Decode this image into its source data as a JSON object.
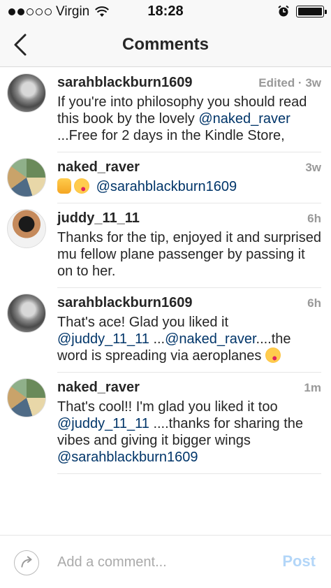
{
  "status_bar": {
    "carrier": "Virgin",
    "time": "18:28",
    "icons": [
      "signal-dots-icon",
      "wifi-icon",
      "alarm-icon",
      "battery-icon"
    ]
  },
  "header": {
    "back_icon": "chevron-left-icon",
    "title": "Comments"
  },
  "comments": [
    {
      "username": "sarahblackburn1609",
      "meta": "Edited · 3w",
      "avatar": "sarah",
      "parts": [
        {
          "t": "text",
          "v": "If you're into philosophy you should read this book by the lovely "
        },
        {
          "t": "mention",
          "v": "@naked_raver"
        },
        {
          "t": "text",
          "v": " ...Free for 2 days in the Kindle Store,"
        }
      ]
    },
    {
      "username": "naked_raver",
      "meta": "3w",
      "avatar": "raver",
      "parts": [
        {
          "t": "emoji",
          "v": "thumb"
        },
        {
          "t": "emoji",
          "v": "kiss"
        },
        {
          "t": "text",
          "v": " "
        },
        {
          "t": "mention",
          "v": "@sarahblackburn1609"
        }
      ]
    },
    {
      "username": "juddy_11_11",
      "meta": "6h",
      "avatar": "juddy",
      "parts": [
        {
          "t": "text",
          "v": "Thanks for the tip, enjoyed it and surprised mu fellow plane passenger by passing it on to her."
        }
      ]
    },
    {
      "username": "sarahblackburn1609",
      "meta": "6h",
      "avatar": "sarah",
      "parts": [
        {
          "t": "text",
          "v": "That's ace! Glad you liked it "
        },
        {
          "t": "mention",
          "v": "@juddy_11_11"
        },
        {
          "t": "text",
          "v": " ..."
        },
        {
          "t": "mention",
          "v": "@naked_raver"
        },
        {
          "t": "text",
          "v": "....the word is spreading via aeroplanes "
        },
        {
          "t": "emoji",
          "v": "kiss"
        }
      ]
    },
    {
      "username": "naked_raver",
      "meta": "1m",
      "avatar": "raver",
      "parts": [
        {
          "t": "text",
          "v": "That's cool!! I'm glad you liked it too "
        },
        {
          "t": "mention",
          "v": "@juddy_11_11"
        },
        {
          "t": "text",
          "v": " ....thanks for sharing the vibes and giving it bigger wings "
        },
        {
          "t": "mention",
          "v": "@sarahblackburn1609"
        }
      ]
    }
  ],
  "composer": {
    "reply_icon": "reply-arrow-icon",
    "placeholder": "Add a comment...",
    "post_label": "Post",
    "post_color": "#b3d6f8"
  },
  "colors": {
    "mention": "#003569",
    "meta": "#999999",
    "text": "#262626"
  }
}
